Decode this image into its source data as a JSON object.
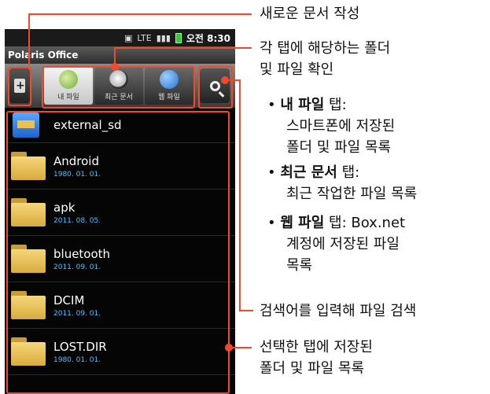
{
  "status_bar": {
    "lte_label": "LTE",
    "time": "오전 8:30"
  },
  "app_title": "Polaris Office",
  "tabs": [
    {
      "label": "내 파일",
      "icon": "my-files-icon",
      "active": true
    },
    {
      "label": "최근 문서",
      "icon": "clock-icon",
      "active": false
    },
    {
      "label": "웹 파일",
      "icon": "globe-icon",
      "active": false
    }
  ],
  "files": [
    {
      "name": "external_sd",
      "date": "",
      "icon": "sd-card-icon"
    },
    {
      "name": "Android",
      "date": "1980. 01. 01.",
      "icon": "folder-icon"
    },
    {
      "name": "apk",
      "date": "2011. 08. 05.",
      "icon": "folder-icon"
    },
    {
      "name": "bluetooth",
      "date": "2011. 09. 01.",
      "icon": "folder-icon"
    },
    {
      "name": "DCIM",
      "date": "2011. 09. 01.",
      "icon": "folder-icon"
    },
    {
      "name": "LOST.DIR",
      "date": "1980. 01. 01.",
      "icon": "folder-icon"
    }
  ],
  "callouts": {
    "new_doc": "새로운 문서 작성",
    "tabs_line1": "각 탭에 해당하는 폴더",
    "tabs_line2": "및 파일 확인",
    "my_files_title": "내 파일",
    "my_files_tab_word": " 탭:",
    "my_files_desc1": "스마트폰에 저장된",
    "my_files_desc2": "폴더 및 파일 목록",
    "recent_title": "최근 문서",
    "recent_tab_word": " 탭:",
    "recent_desc": "최근 작업한 파일 목록",
    "web_title": "웹 파일",
    "web_tab_word": " 탭: Box.net",
    "web_desc1": "계정에 저장된 파일",
    "web_desc2": "목록",
    "search": "검색어를 입력해 파일 검색",
    "list_line1": "선택한 탭에 저장된",
    "list_line2": "폴더 및 파일 목록"
  },
  "colors": {
    "callout": "#f04a2a",
    "date": "#4fc1ff"
  }
}
